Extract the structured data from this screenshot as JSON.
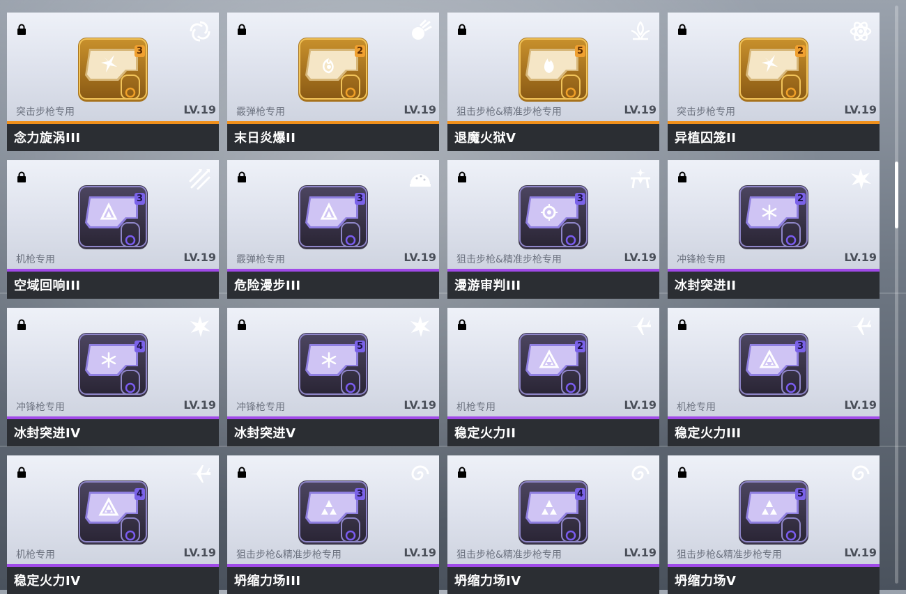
{
  "cards": [
    {
      "tier": "gold",
      "weapon": "突击步枪专用",
      "level": "LV.19",
      "name": "念力旋涡III",
      "rank": "3",
      "chip_icon": "shuriken-icon",
      "element_icon": "vortex-icon"
    },
    {
      "tier": "gold",
      "weapon": "霰弹枪专用",
      "level": "LV.19",
      "name": "末日炎爆II",
      "rank": "2",
      "chip_icon": "flame-swirl-icon",
      "element_icon": "meteor-icon"
    },
    {
      "tier": "gold",
      "weapon": "狙击步枪&精准步枪专用",
      "level": "LV.19",
      "name": "退魔火狱V",
      "rank": "5",
      "chip_icon": "fire-icon",
      "element_icon": "flame-lotus-icon"
    },
    {
      "tier": "gold",
      "weapon": "突击步枪专用",
      "level": "LV.19",
      "name": "异植囚笼II",
      "rank": "2",
      "chip_icon": "shuriken-icon",
      "element_icon": "atom-icon"
    },
    {
      "tier": "purple",
      "weapon": "机枪专用",
      "level": "LV.19",
      "name": "空域回响III",
      "rank": "3",
      "chip_icon": "triangle-icon",
      "element_icon": "missiles-icon"
    },
    {
      "tier": "purple",
      "weapon": "霰弹枪专用",
      "level": "LV.19",
      "name": "危险漫步III",
      "rank": "3",
      "chip_icon": "triangle-icon",
      "element_icon": "dome-icon"
    },
    {
      "tier": "purple",
      "weapon": "狙击步枪&精准步枪专用",
      "level": "LV.19",
      "name": "漫游审判III",
      "rank": "3",
      "chip_icon": "target-icon",
      "element_icon": "turret-icon"
    },
    {
      "tier": "purple",
      "weapon": "冲锋枪专用",
      "level": "LV.19",
      "name": "冰封突进II",
      "rank": "2",
      "chip_icon": "snowflake-icon",
      "element_icon": "ice-burst-icon"
    },
    {
      "tier": "purple",
      "weapon": "冲锋枪专用",
      "level": "LV.19",
      "name": "冰封突进IV",
      "rank": "4",
      "chip_icon": "snowflake-icon",
      "element_icon": "ice-burst-icon"
    },
    {
      "tier": "purple",
      "weapon": "冲锋枪专用",
      "level": "LV.19",
      "name": "冰封突进V",
      "rank": "5",
      "chip_icon": "snowflake-icon",
      "element_icon": "ice-burst-icon"
    },
    {
      "tier": "purple",
      "weapon": "机枪专用",
      "level": "LV.19",
      "name": "稳定火力II",
      "rank": "2",
      "chip_icon": "tri-triangle-icon",
      "element_icon": "jet-icon"
    },
    {
      "tier": "purple",
      "weapon": "机枪专用",
      "level": "LV.19",
      "name": "稳定火力III",
      "rank": "3",
      "chip_icon": "tri-triangle-icon",
      "element_icon": "jet-icon"
    },
    {
      "tier": "purple",
      "weapon": "机枪专用",
      "level": "LV.19",
      "name": "稳定火力IV",
      "rank": "4",
      "chip_icon": "tri-triangle-icon",
      "element_icon": "jet-icon"
    },
    {
      "tier": "purple",
      "weapon": "狙击步枪&精准步枪专用",
      "level": "LV.19",
      "name": "坍缩力场III",
      "rank": "3",
      "chip_icon": "tri-shard-icon",
      "element_icon": "spiral-icon"
    },
    {
      "tier": "purple",
      "weapon": "狙击步枪&精准步枪专用",
      "level": "LV.19",
      "name": "坍缩力场IV",
      "rank": "4",
      "chip_icon": "tri-shard-icon",
      "element_icon": "spiral-icon"
    },
    {
      "tier": "purple",
      "weapon": "狙击步枪&精准步枪专用",
      "level": "LV.19",
      "name": "坍缩力场V",
      "rank": "5",
      "chip_icon": "tri-shard-icon",
      "element_icon": "spiral-icon"
    }
  ],
  "colors": {
    "gold_stripe": "#f0901c",
    "purple_stripe": "#a04ae8",
    "name_bar": "#2b2e33",
    "gold_rank": "#f08a1a",
    "purple_rank": "#5a3fd0"
  }
}
